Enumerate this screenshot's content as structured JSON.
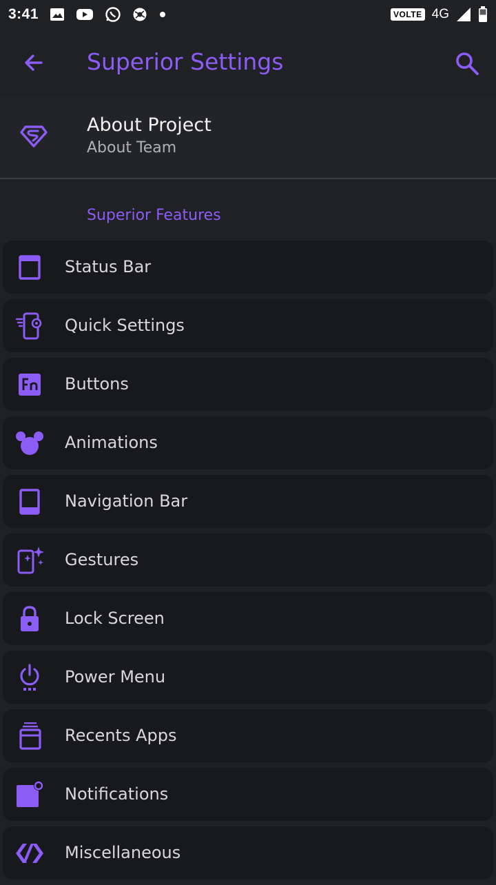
{
  "status_bar": {
    "time": "3:41",
    "volte": "VOLTE",
    "network": "4G",
    "icons": [
      "image-icon",
      "youtube-icon",
      "whatsapp-icon",
      "chrome-like-icon",
      "dot-icon",
      "signal-icon",
      "battery-icon"
    ]
  },
  "app_bar": {
    "title": "Superior Settings",
    "back_icon": "arrow-left-icon",
    "search_icon": "search-icon"
  },
  "about": {
    "title": "About Project",
    "subtitle": "About Team",
    "icon": "superman-logo-icon"
  },
  "section": {
    "header": "Superior Features"
  },
  "items": [
    {
      "label": "Status Bar",
      "icon": "status-bar-icon"
    },
    {
      "label": "Quick Settings",
      "icon": "quick-settings-icon"
    },
    {
      "label": "Buttons",
      "icon": "fn-key-icon"
    },
    {
      "label": "Animations",
      "icon": "mouse-ears-icon"
    },
    {
      "label": "Navigation Bar",
      "icon": "navigation-bar-icon"
    },
    {
      "label": "Gestures",
      "icon": "gestures-sparkle-icon"
    },
    {
      "label": "Lock Screen",
      "icon": "lock-icon"
    },
    {
      "label": "Power Menu",
      "icon": "power-icon"
    },
    {
      "label": "Recents Apps",
      "icon": "recents-icon"
    },
    {
      "label": "Notifications",
      "icon": "notification-dot-icon"
    },
    {
      "label": "Miscellaneous",
      "icon": "code-icon"
    }
  ],
  "colors": {
    "accent": "#8b5cf6",
    "background": "#202125",
    "card": "#18191c"
  }
}
